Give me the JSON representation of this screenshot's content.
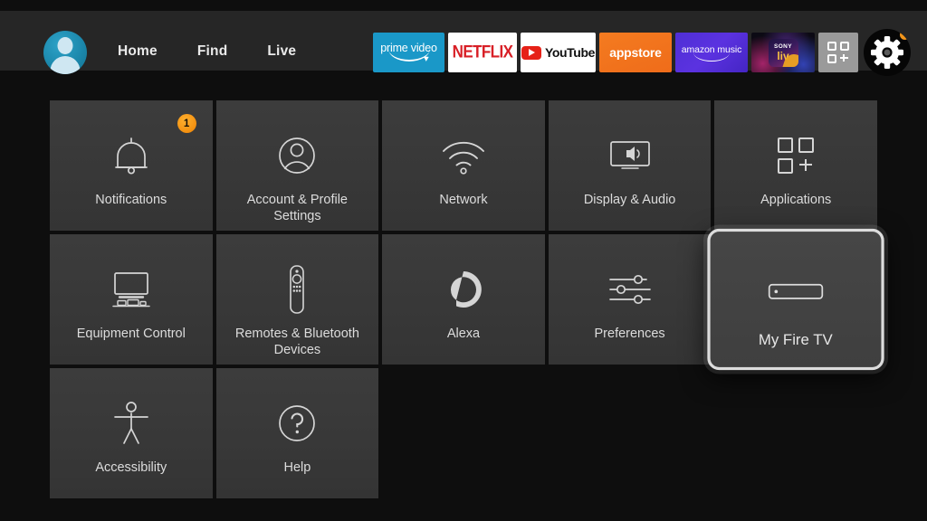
{
  "header": {
    "avatar": {
      "icon": "user-avatar-icon"
    },
    "nav": [
      {
        "label": "Home"
      },
      {
        "label": "Find"
      },
      {
        "label": "Live"
      }
    ],
    "apps": [
      {
        "name": "prime-video",
        "text": "prime video"
      },
      {
        "name": "netflix",
        "text": "NETFLIX"
      },
      {
        "name": "youtube",
        "text": "YouTube"
      },
      {
        "name": "appstore",
        "text": "appstore"
      },
      {
        "name": "amazon-music",
        "text": "amazon music"
      },
      {
        "name": "sony-liv",
        "text_top": "SONY",
        "text_bottom": "liv"
      },
      {
        "name": "apps-grid",
        "icon": "apps-grid-plus-icon"
      },
      {
        "name": "settings-gear",
        "icon": "gear-icon",
        "badge_color": "#f2951b"
      }
    ]
  },
  "settings": {
    "tiles": [
      {
        "label": "Notifications",
        "icon": "bell-icon",
        "badge": "1",
        "focused": false
      },
      {
        "label": "Account & Profile Settings",
        "icon": "user-circle-icon",
        "focused": false
      },
      {
        "label": "Network",
        "icon": "wifi-icon",
        "focused": false
      },
      {
        "label": "Display & Audio",
        "icon": "tv-speaker-icon",
        "focused": false
      },
      {
        "label": "Applications",
        "icon": "apps-grid-plus-icon",
        "focused": false
      },
      {
        "label": "Equipment Control",
        "icon": "tv-soundbar-icon",
        "focused": false
      },
      {
        "label": "Remotes & Bluetooth Devices",
        "icon": "remote-control-icon",
        "focused": false
      },
      {
        "label": "Alexa",
        "icon": "alexa-ring-icon",
        "focused": false
      },
      {
        "label": "Preferences",
        "icon": "sliders-icon",
        "focused": false
      },
      {
        "label": "My Fire TV",
        "icon": "fire-tv-stick-icon",
        "focused": true
      },
      {
        "label": "Accessibility",
        "icon": "accessibility-person-icon",
        "focused": false
      },
      {
        "label": "Help",
        "icon": "question-circle-icon",
        "focused": false
      }
    ]
  },
  "colors": {
    "background": "#0e0e0e",
    "header_band": "#262626",
    "tile": "#3a3a3a",
    "tile_text": "#dcdcdc",
    "accent_orange": "#f2951b",
    "focus_border": "#dcdcdc"
  }
}
